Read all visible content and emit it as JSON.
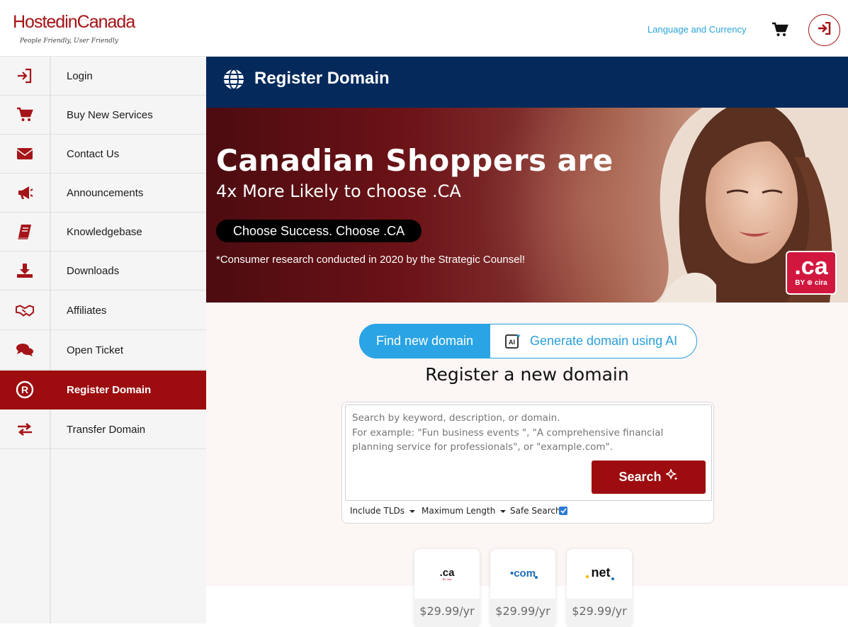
{
  "header": {
    "logo_main": "HostedinCanada",
    "logo_tagline": "People Friendly, User Friendly",
    "language_link": "Language and Currency",
    "cart_icon": "cart-icon",
    "login_icon": "login-icon"
  },
  "sidebar": {
    "items": [
      {
        "label": "Login",
        "icon": "login-icon"
      },
      {
        "label": "Buy New Services",
        "icon": "cart-icon"
      },
      {
        "label": "Contact Us",
        "icon": "envelope-icon"
      },
      {
        "label": "Announcements",
        "icon": "megaphone-icon"
      },
      {
        "label": "Knowledgebase",
        "icon": "book-icon"
      },
      {
        "label": "Downloads",
        "icon": "download-icon"
      },
      {
        "label": "Affiliates",
        "icon": "handshake-icon"
      },
      {
        "label": "Open Ticket",
        "icon": "chat-icon"
      },
      {
        "label": "Register Domain",
        "icon": "registered-icon",
        "active": true
      },
      {
        "label": "Transfer Domain",
        "icon": "transfer-icon"
      }
    ]
  },
  "page_title": "Register Domain",
  "banner": {
    "headline": "Canadian Shoppers are",
    "subheadline": "4x More Likely to choose .CA",
    "pill": "Choose Success. Choose .CA",
    "note": "*Consumer research conducted in 2020 by the Strategic Counsel!",
    "badge_big": ".ca",
    "badge_small": "BY ⊕ cira"
  },
  "toggle": {
    "find": "Find new domain",
    "ai": "Generate domain using AI"
  },
  "register_title": "Register a new domain",
  "search": {
    "placeholder": "Search by keyword, description, or domain.\nFor example: \"Fun business events \", \"A comprehensive financial planning service for professionals\", or \"example.com\".",
    "button": "Search",
    "include_tlds": "Include TLDs",
    "max_length": "Maximum Length",
    "safe_search": "Safe Search",
    "safe_search_checked": true
  },
  "tlds": [
    {
      "name": ".ca",
      "price": "$29.99/yr"
    },
    {
      "name": ".com",
      "price": "$29.99/yr"
    },
    {
      "name": ".net",
      "price": "$29.99/yr"
    }
  ],
  "colors": {
    "brand_red": "#9d0d0f",
    "navy": "#042a5c",
    "accent_blue": "#2aa4e4"
  }
}
